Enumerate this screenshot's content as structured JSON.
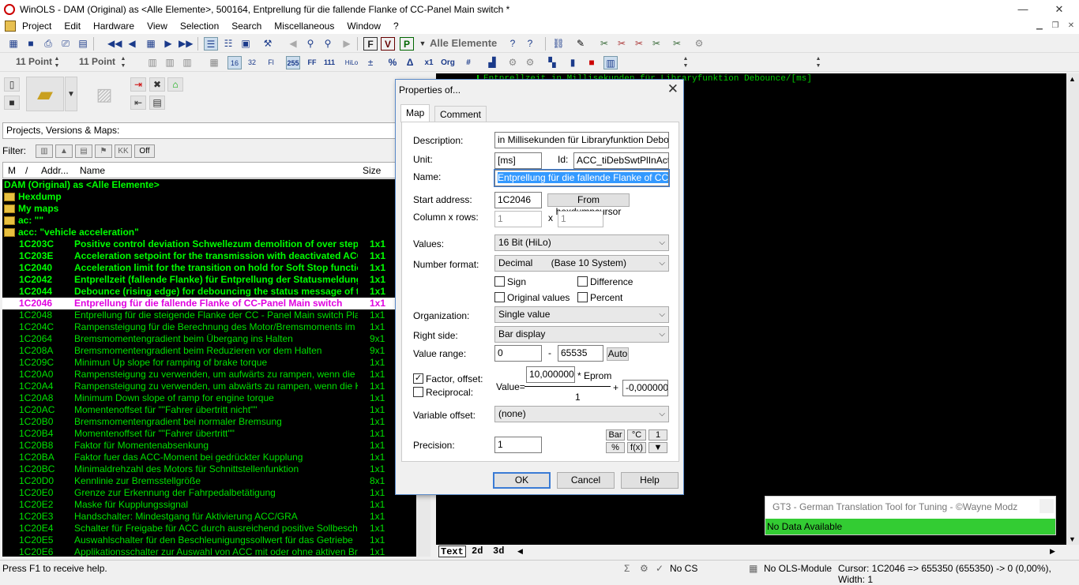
{
  "window": {
    "title": "WinOLS - DAM (Original) as <Alle Elemente>, 500164, Entprellung für die fallende Flanke of CC-Panel Main switch *",
    "minimize": "—",
    "restore": "❐",
    "close": "✕"
  },
  "menu": [
    "Project",
    "Edit",
    "Hardware",
    "View",
    "Selection",
    "Search",
    "Miscellaneous",
    "Window",
    "?"
  ],
  "toolbar": {
    "elements_combo": "Alle Elemente",
    "font_left": "11 Point",
    "font_right": "11 Point"
  },
  "left": {
    "projects_label": "Projects, Versions & Maps:",
    "filter_label": "Filter:",
    "filter_off": "Off",
    "columns": {
      "m": "M",
      "slash": "/",
      "addr": "Addr...",
      "name": "Name",
      "size": "Size"
    },
    "root": "DAM (Original) as <Alle Elemente>",
    "folders": [
      "Hexdump",
      "My maps",
      "ac: \"\"",
      "acc: \"vehicle acceleration\""
    ],
    "rows": [
      {
        "addr": "1C203C",
        "name": "Positive control deviation Schwellezum demolition of over stepp",
        "size": "1x1",
        "style": "bold"
      },
      {
        "addr": "1C203E",
        "name": "Acceleration setpoint for the transmission with deactivated ACC",
        "size": "1x1",
        "style": "bold"
      },
      {
        "addr": "1C2040",
        "name": "Acceleration limit for the transition on hold for Soft Stop functio",
        "size": "1x1",
        "style": "bold"
      },
      {
        "addr": "1C2042",
        "name": "Entprellzeit (fallende Flanke) für Entprellung der Statusmeldung",
        "size": "1x1",
        "style": "bold"
      },
      {
        "addr": "1C2044",
        "name": "Debounce (rising edge) for debouncing the status message of t",
        "size": "1x1",
        "style": "bold"
      },
      {
        "addr": "1C2046",
        "name": "Entprellung für die fallende Flanke of CC-Panel Main switch",
        "size": "1x1",
        "style": "sel"
      },
      {
        "addr": "1C2048",
        "name": "Entprellung für die steigende Flanke der CC - Panel Main switch Plausibilität",
        "size": "1x1",
        "style": "norm"
      },
      {
        "addr": "1C204C",
        "name": "Rampensteigung für die Berechnung des Motor/Bremsmoments im State INA",
        "size": "1x1",
        "style": "norm"
      },
      {
        "addr": "1C2064",
        "name": "Bremsmomentengradient beim Übergang ins Halten",
        "size": "9x1",
        "style": "norm"
      },
      {
        "addr": "1C208A",
        "name": "Bremsmomentengradient beim Reduzieren vor dem Halten",
        "size": "9x1",
        "style": "norm"
      },
      {
        "addr": "1C209C",
        "name": "Minimun Up slope for ramping of brake torque",
        "size": "1x1",
        "style": "norm"
      },
      {
        "addr": "1C20A0",
        "name": "Rampensteigung zu verwenden, um aufwärts zu rampen,  wenn die Kupplun",
        "size": "1x1",
        "style": "norm"
      },
      {
        "addr": "1C20A4",
        "name": "Rampensteigung zu verwenden, um abwärts zu rampen, wenn die Kupplung",
        "size": "1x1",
        "style": "norm"
      },
      {
        "addr": "1C20A8",
        "name": "Minimum Down slope of ramp for engine torque",
        "size": "1x1",
        "style": "norm"
      },
      {
        "addr": "1C20AC",
        "name": "Momentenoffset für \"\"Fahrer übertritt nicht\"\"",
        "size": "1x1",
        "style": "norm"
      },
      {
        "addr": "1C20B0",
        "name": "Bremsmomentengradient bei normaler Bremsung",
        "size": "1x1",
        "style": "norm"
      },
      {
        "addr": "1C20B4",
        "name": "Momentenoffset für \"\"Fahrer übertritt\"\"",
        "size": "1x1",
        "style": "norm"
      },
      {
        "addr": "1C20B8",
        "name": "Faktor für Momentenabsenkung",
        "size": "1x1",
        "style": "norm"
      },
      {
        "addr": "1C20BA",
        "name": "Faktor fuer das ACC-Moment bei gedrückter Kupplung",
        "size": "1x1",
        "style": "norm"
      },
      {
        "addr": "1C20BC",
        "name": "Minimaldrehzahl des Motors für Schnittstellenfunktion",
        "size": "1x1",
        "style": "norm"
      },
      {
        "addr": "1C20D0",
        "name": "Kennlinie zur Bremsstellgröße",
        "size": "8x1",
        "style": "norm"
      },
      {
        "addr": "1C20E0",
        "name": "Grenze zur Erkennung der Fahrpedalbetätigung",
        "size": "1x1",
        "style": "norm"
      },
      {
        "addr": "1C20E2",
        "name": "Maske für Kupplungssignal",
        "size": "1x1",
        "style": "norm"
      },
      {
        "addr": "1C20E3",
        "name": "Handschalter: Mindestgang für Aktivierung ACC/GRA",
        "size": "1x1",
        "style": "norm"
      },
      {
        "addr": "1C20E4",
        "name": "Schalter für Freigabe für ACC durch ausreichend positive Sollbeschleunigung",
        "size": "1x1",
        "style": "norm"
      },
      {
        "addr": "1C20E5",
        "name": "Auswahlschalter für den Beschleunigungssollwert für das Getriebe",
        "size": "1x1",
        "style": "norm"
      },
      {
        "addr": "1C20E6",
        "name": "Applikationsschalter zur Auswahl von ACC mit oder ohne aktiven Bremsverst",
        "size": "1x1",
        "style": "norm"
      }
    ]
  },
  "hex": {
    "line": "Entprellzeit in Millisekunden für Libraryfunktion Debounce/[ms]",
    "tabs": [
      "Text",
      "2d",
      "3d"
    ]
  },
  "dialog": {
    "title": "Properties of...",
    "close": "✕",
    "tabs": [
      "Map",
      "Comment"
    ],
    "description_label": "Description:",
    "description_value": "in Millisekunden für Libraryfunktion Debounce",
    "unit_label": "Unit:",
    "unit_value": "[ms]",
    "id_label": "Id:",
    "id_value": "ACC_tiDebSwtPlInAct_C",
    "name_label": "Name:",
    "name_value": "Entprellung für die fallende Flanke of CC-Panel",
    "start_label": "Start address:",
    "start_value": "1C2046",
    "from_hex": "From hexdumpcursor",
    "colrow_label": "Column x rows:",
    "col_value": "1",
    "x": "x",
    "row_value": "1",
    "values_label": "Values:",
    "values_value": "16 Bit (HiLo)",
    "numfmt_label": "Number format:",
    "numfmt_value": "Decimal       (Base 10 System)",
    "sign": "Sign",
    "difference": "Difference",
    "original_values": "Original values",
    "percent": "Percent",
    "org_label": "Organization:",
    "org_value": "Single value",
    "right_label": "Right side:",
    "right_value": "Bar display",
    "range_label": "Value range:",
    "range_min": "0",
    "range_dash": "-",
    "range_max": "65535",
    "auto": "Auto",
    "factor_label": "Factor, offset:",
    "reciprocal_label": "Reciprocal:",
    "value_eq": "Value=",
    "factor_value": "10,000000",
    "eprom": "* Eprom",
    "divisor": "1",
    "plus": "+",
    "offset_value": "-0,000000",
    "varoff_label": "Variable offset:",
    "varoff_value": "(none)",
    "precision_label": "Precision:",
    "precision_value": "1",
    "bar": "Bar",
    "degc": "°C",
    "one": "1",
    "pct": "%",
    "fx": "f(x)",
    "down": "▼",
    "ok": "OK",
    "cancel": "Cancel",
    "help": "Help"
  },
  "gt3": {
    "title": "GT3 - German Translation Tool for Tuning - ©Wayne Modz",
    "status": "No Data Available"
  },
  "status": {
    "help": "Press F1 to receive help.",
    "cs": "No CS",
    "ols": "No OLS-Module",
    "cursor": "Cursor: 1C2046 => 655350 (655350) -> 0 (0,00%), Width: 1"
  }
}
